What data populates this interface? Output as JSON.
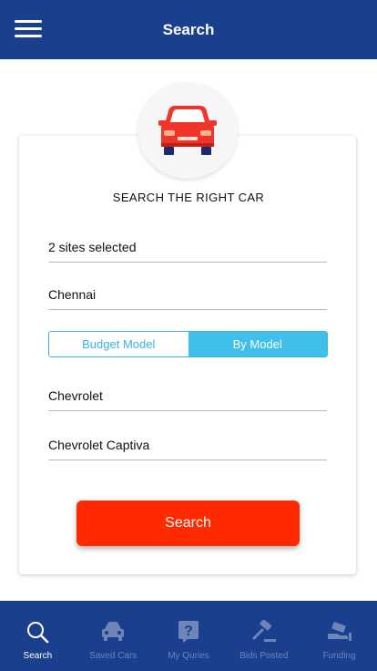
{
  "header": {
    "title": "Search",
    "menu_icon": "hamburger-menu-icon"
  },
  "card": {
    "car_icon": "car-front-icon",
    "heading": "SEARCH THE RIGHT CAR",
    "sites_value": "2 sites selected",
    "city_value": "Chennai",
    "toggle": {
      "option_budget": "Budget Model",
      "option_model": "By Model",
      "selected": "By Model"
    },
    "make_value": "Chevrolet",
    "model_value": "Chevrolet Captiva",
    "search_label": "Search"
  },
  "bottom_nav": {
    "items": [
      {
        "label": "Search",
        "icon": "search-icon",
        "active": true
      },
      {
        "label": "Saved Cars",
        "icon": "car-icon",
        "active": false
      },
      {
        "label": "My Quries",
        "icon": "question-icon",
        "active": false
      },
      {
        "label": "Bids Posted",
        "icon": "gavel-icon",
        "active": false
      },
      {
        "label": "Funding",
        "icon": "money-hand-icon",
        "active": false
      }
    ]
  },
  "colors": {
    "primary": "#1a3f8c",
    "accent": "#ff2a00",
    "toggle": "#3fbfe9"
  }
}
